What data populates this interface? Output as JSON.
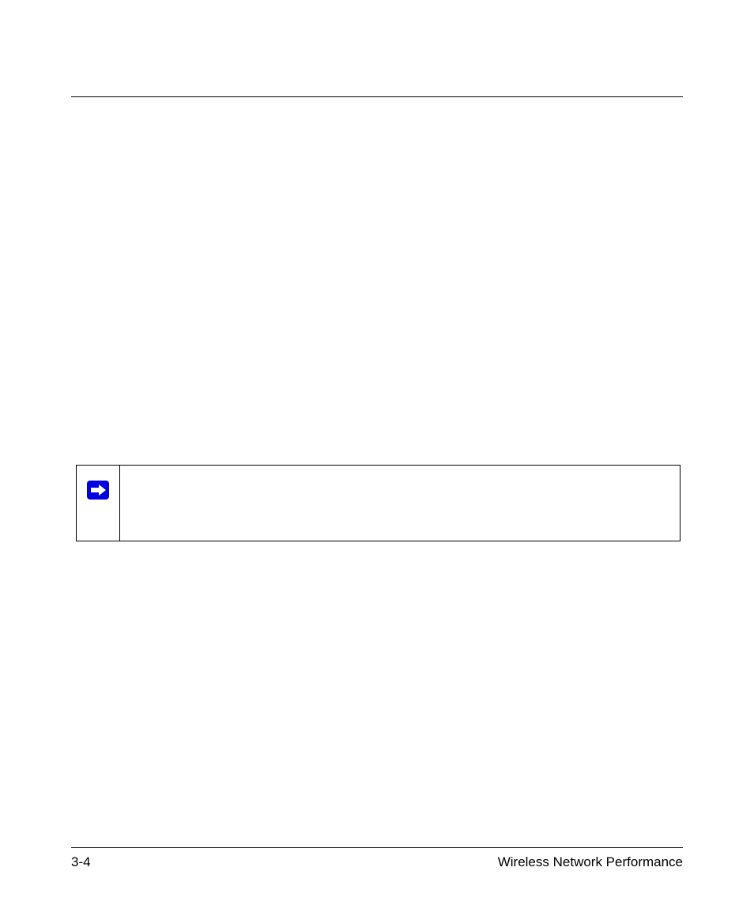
{
  "footer": {
    "page_number": "3-4",
    "section_title": "Wireless Network Performance"
  },
  "note": {
    "icon": "arrow-right-icon"
  }
}
